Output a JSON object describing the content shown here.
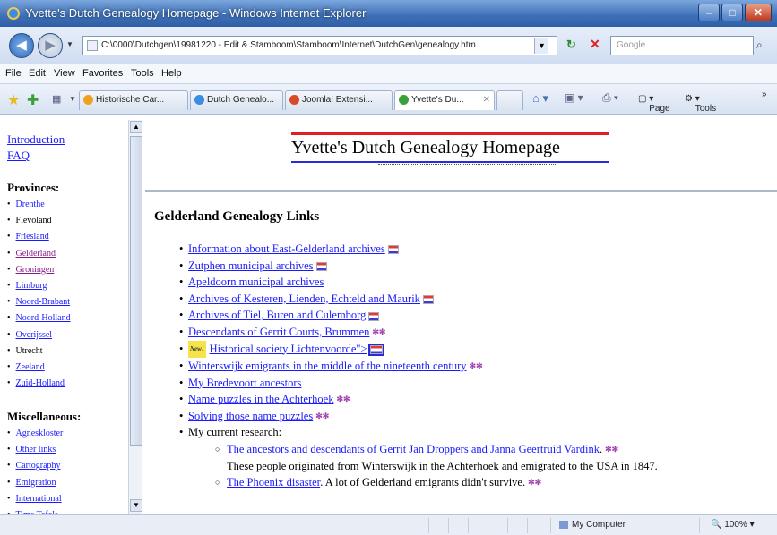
{
  "window": {
    "title": "Yvette's Dutch Genealogy Homepage - Windows Internet Explorer"
  },
  "address": {
    "url": "C:\\0000\\Dutchgen\\19981220 - Edit & Stamboom\\Stamboom\\Internet\\DutchGen\\genealogy.htm",
    "search_placeholder": "Google"
  },
  "menu": [
    "File",
    "Edit",
    "View",
    "Favorites",
    "Tools",
    "Help"
  ],
  "tabs": [
    {
      "label": "Historische Car...",
      "active": false
    },
    {
      "label": "Dutch Genealo...",
      "active": false
    },
    {
      "label": "Joomla! Extensi...",
      "active": false
    },
    {
      "label": "Yvette's Du...",
      "active": true
    }
  ],
  "commands": {
    "page": "Page",
    "tools": "Tools"
  },
  "nav": {
    "top_links": [
      "Introduction",
      "FAQ"
    ],
    "provinces_heading": "Provinces:",
    "provinces": [
      {
        "label": "Drenthe",
        "link": true
      },
      {
        "label": "Flevoland",
        "link": false
      },
      {
        "label": "Friesland",
        "link": true
      },
      {
        "label": "Gelderland",
        "link": true,
        "visited": true
      },
      {
        "label": "Groningen",
        "link": true,
        "visited": true
      },
      {
        "label": "Limburg",
        "link": true
      },
      {
        "label": "Noord-Brabant",
        "link": true
      },
      {
        "label": "Noord-Holland",
        "link": true
      },
      {
        "label": "Overijssel",
        "link": true
      },
      {
        "label": "Utrecht",
        "link": false
      },
      {
        "label": "Zeeland",
        "link": true
      },
      {
        "label": "Zuid-Holland",
        "link": true
      }
    ],
    "misc_heading": "Miscellaneous:",
    "misc": [
      "Agneskloster",
      "Other links",
      "Cartography",
      "Emigration",
      "International",
      "Time Tafels"
    ]
  },
  "header": {
    "title": "Yvette's Dutch Genealogy Homepage"
  },
  "main": {
    "heading": "Gelderland Genealogy Links",
    "links": [
      {
        "text": "Information about East-Gelderland archives",
        "badge": "nl"
      },
      {
        "text": "Zutphen municipal archives",
        "badge": "nl"
      },
      {
        "text": "Apeldoorn municipal archives",
        "badge": ""
      },
      {
        "text": "Archives of Kesteren, Lienden, Echteld and Maurik",
        "badge": "nl"
      },
      {
        "text": "Archives of Tiel, Buren and Culemborg",
        "badge": "nl"
      },
      {
        "text": "Descendants of Gerrit Courts, Brummen",
        "badge": "us"
      },
      {
        "text": "Historical society Lichtenvoorde\">",
        "badge": "nl-boxed",
        "new": "New!"
      },
      {
        "text": "Winterswijk emigrants in the middle of the nineteenth century",
        "badge": "us"
      },
      {
        "text": "My Bredevoort ancestors",
        "badge": ""
      },
      {
        "text": "Name puzzles in the Achterhoek",
        "badge": "us"
      },
      {
        "text": "Solving those name puzzles",
        "badge": "us"
      }
    ],
    "research_label": "My current research:",
    "research": [
      {
        "link": "The ancestors and descendants of Gerrit Jan Droppers and Janna Geertruid Vardink",
        "after": ".",
        "desc": "These people originated from Winterswijk in the Achterhoek and emigrated to the USA in 1847."
      },
      {
        "link": "The Phoenix disaster",
        "after": ". A lot of Gelderland emigrants didn't survive.",
        "desc": ""
      }
    ]
  },
  "status": {
    "zone": "My Computer",
    "zoom": "100%"
  }
}
